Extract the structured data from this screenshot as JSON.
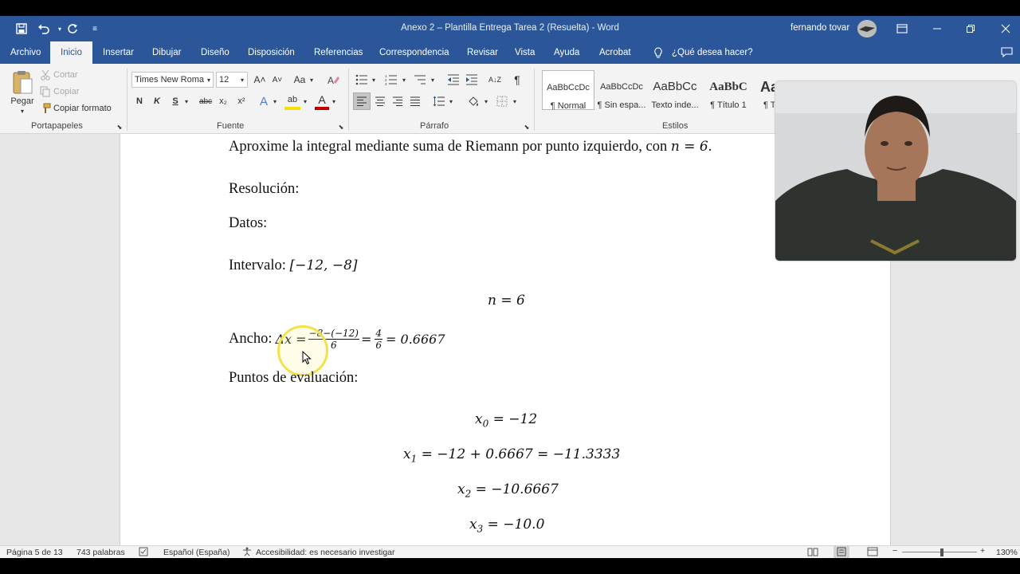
{
  "titlebar": {
    "title": "Anexo 2 – Plantilla Entrega Tarea 2 (Resuelta)  -  Word",
    "user": "fernando tovar",
    "qat_more": "≡"
  },
  "tabs": [
    "Archivo",
    "Inicio",
    "Insertar",
    "Dibujar",
    "Diseño",
    "Disposición",
    "Referencias",
    "Correspondencia",
    "Revisar",
    "Vista",
    "Ayuda",
    "Acrobat",
    "¿Qué desea hacer?"
  ],
  "ribbon": {
    "clipboard": {
      "paste": "Pegar",
      "cut": "Cortar",
      "copy": "Copiar",
      "format_painter": "Copiar formato",
      "group": "Portapapeles"
    },
    "font": {
      "font_name": "Times New Roma",
      "font_size": "12",
      "grow": "A˄",
      "shrink": "A˅",
      "case": "Aa",
      "bold": "N",
      "italic": "K",
      "underline": "S",
      "strike": "abc",
      "subscript": "x₂",
      "superscript": "x²",
      "effects": "A",
      "highlight": "ab",
      "font_color": "A",
      "group": "Fuente"
    },
    "paragraph": {
      "group": "Párrafo",
      "pilcrow": "¶",
      "sort": "A↓Z"
    },
    "styles": {
      "group": "Estilos",
      "items": [
        {
          "sample": "AaBbCcDc",
          "name": "¶ Normal"
        },
        {
          "sample": "AaBbCcDc",
          "name": "¶ Sin espa..."
        },
        {
          "sample": "AaBbCc",
          "name": "Texto inde..."
        },
        {
          "sample": "AaBbC",
          "name": "¶ Título 1"
        },
        {
          "sample": "Aa",
          "name": "¶ T"
        }
      ]
    }
  },
  "document": {
    "line1_text": "Aproxime la integral mediante suma de Riemann por punto izquierdo, con ",
    "line1_math": "n = 6",
    "line1_end": ".",
    "resolucion": "Resolución:",
    "datos": "Datos:",
    "intervalo_label": "Intervalo: ",
    "intervalo_value": "[−12, −8]",
    "n_eq": "n = 6",
    "ancho_label": "Ancho: ",
    "ancho_lhs": "Δx =",
    "frac1_num": "−8−(−12)",
    "frac1_den": "6",
    "eq1": "=",
    "frac2_num": "4",
    "frac2_den": "6",
    "ancho_result": "= 0.6667",
    "puntos": "Puntos de evaluación:",
    "x0_var": "x",
    "x0_sub": "0",
    "x0_rhs": " = −12",
    "x1_var": "x",
    "x1_sub": "1",
    "x1_rhs": " = −12 + 0.6667 = −11.3333",
    "x2_var": "x",
    "x2_sub": "2",
    "x2_rhs": " = −10.6667",
    "x3_var": "x",
    "x3_sub": "3",
    "x3_rhs": " = −10.0"
  },
  "statusbar": {
    "page": "Página 5 de 13",
    "words": "743 palabras",
    "language": "Español (España)",
    "accessibility": "Accesibilidad: es necesario investigar",
    "zoom_minus": "−",
    "zoom_plus": "+",
    "zoom": "130%"
  },
  "colors": {
    "accent": "#2b579a",
    "ribbon_bg": "#f3f3f3",
    "highlight_ring": "#f2e24a"
  }
}
